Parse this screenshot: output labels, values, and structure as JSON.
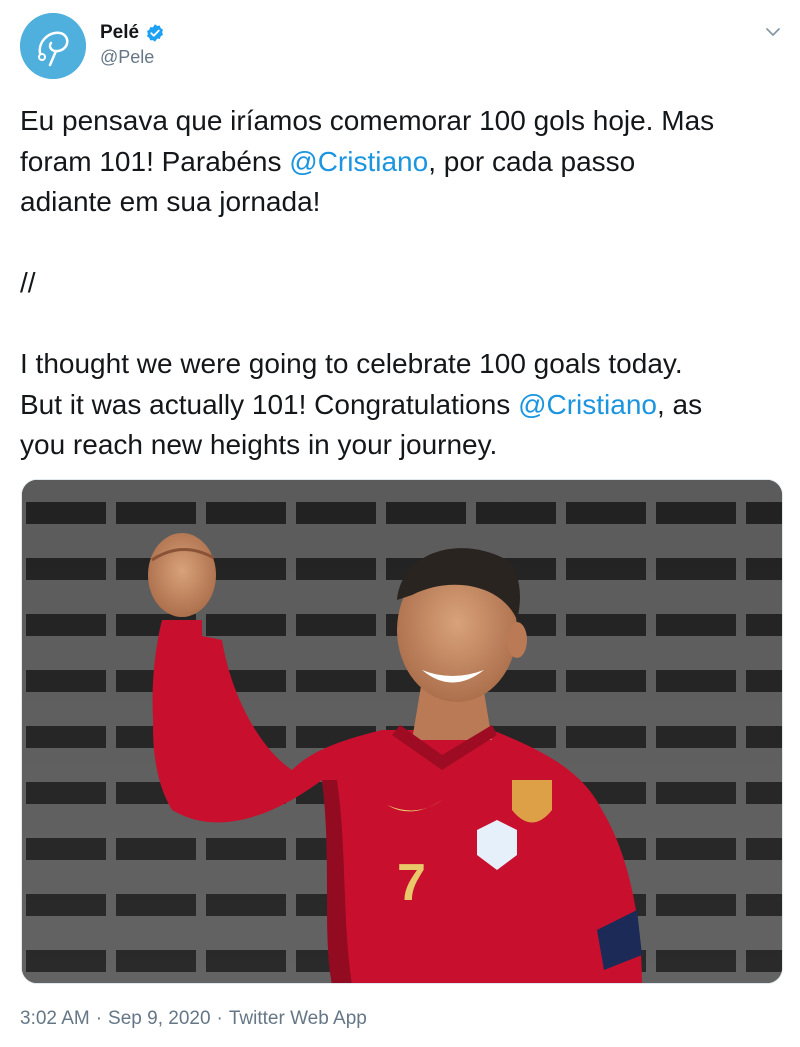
{
  "author": {
    "display_name": "Pelé",
    "handle": "@Pele",
    "avatar_icon": "pele-logo-avatar",
    "verified_icon": "verified-badge-icon",
    "brand_color": "#4fb0de",
    "verified_color": "#1da1f2"
  },
  "menu": {
    "caret_icon": "chevron-down-icon"
  },
  "tweet": {
    "part1": "Eu pensava que iríamos comemorar 100 gols hoje. Mas\nforam 101! Parabéns ",
    "mention1": "@Cristiano",
    "part2": ", por cada passo\nadiante em sua jornada!\n\n//\n\nI thought we were going to celebrate 100 goals today.\nBut it was actually 101! Congratulations ",
    "mention2": "@Cristiano",
    "part3": ", as\nyou reach new heights in your journey.",
    "mention_color": "#1b95e0"
  },
  "media": {
    "jersey_number": "7"
  },
  "footer": {
    "time": "3:02 AM",
    "sep1": "·",
    "date": "Sep 9, 2020",
    "sep2": "·",
    "source": "Twitter Web App"
  }
}
